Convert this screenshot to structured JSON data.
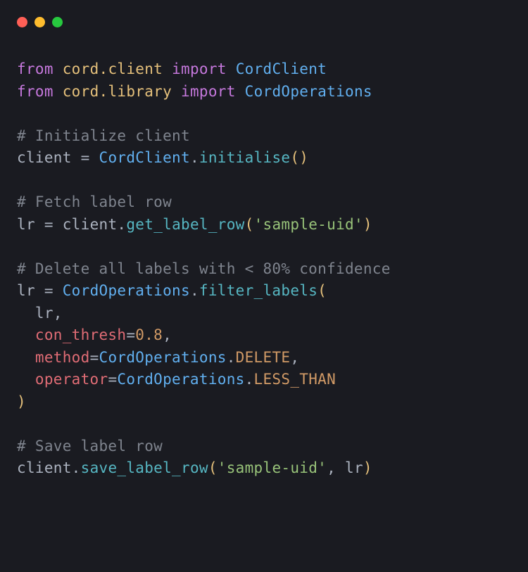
{
  "code": {
    "l1_from": "from",
    "l1_mod": "cord.client",
    "l1_import": "import",
    "l1_cls": "CordClient",
    "l2_from": "from",
    "l2_mod": "cord.library",
    "l2_import": "import",
    "l2_cls": "CordOperations",
    "c1": "# Initialize client",
    "l3_var": "client",
    "l3_eq": " = ",
    "l3_cls": "CordClient",
    "l3_dot": ".",
    "l3_fn": "initialise",
    "l3_par": "()",
    "c2": "# Fetch label row",
    "l4_var": "lr",
    "l4_eq": " = ",
    "l4_obj": "client",
    "l4_dot": ".",
    "l4_fn": "get_label_row",
    "l4_po": "(",
    "l4_str": "'sample-uid'",
    "l4_pc": ")",
    "c3": "# Delete all labels with < 80% confidence",
    "l5_var": "lr",
    "l5_eq": " = ",
    "l5_cls": "CordOperations",
    "l5_dot": ".",
    "l5_fn": "filter_labels",
    "l5_po": "(",
    "l6_indent": "  ",
    "l6_arg": "lr",
    "l6_comma": ",",
    "l7_indent": "  ",
    "l7_arg": "con_thresh",
    "l7_eq": "=",
    "l7_num": "0.8",
    "l7_comma": ",",
    "l8_indent": "  ",
    "l8_arg": "method",
    "l8_eq": "=",
    "l8_cls": "CordOperations",
    "l8_dot": ".",
    "l8_const": "DELETE",
    "l8_comma": ",",
    "l9_indent": "  ",
    "l9_arg": "operator",
    "l9_eq": "=",
    "l9_cls": "CordOperations",
    "l9_dot": ".",
    "l9_const": "LESS_THAN",
    "l10_pc": ")",
    "c4": "# Save label row",
    "l11_obj": "client",
    "l11_dot": ".",
    "l11_fn": "save_label_row",
    "l11_po": "(",
    "l11_str": "'sample-uid'",
    "l11_comma": ", ",
    "l11_arg": "lr",
    "l11_pc": ")"
  }
}
